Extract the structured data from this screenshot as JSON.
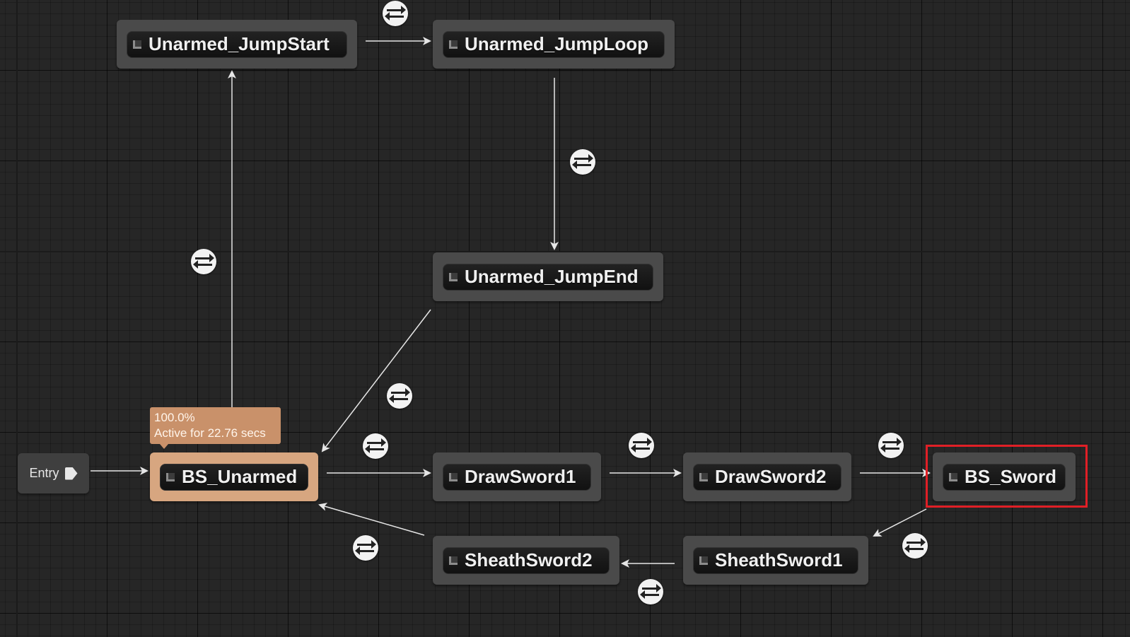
{
  "entry": {
    "label": "Entry"
  },
  "states": {
    "jump_start": "Unarmed_JumpStart",
    "jump_loop": "Unarmed_JumpLoop",
    "jump_end": "Unarmed_JumpEnd",
    "bs_unarmed": "BS_Unarmed",
    "draw_sword1": "DrawSword1",
    "draw_sword2": "DrawSword2",
    "bs_sword": "BS_Sword",
    "sheath_sword2": "SheathSword2",
    "sheath_sword1": "SheathSword1"
  },
  "active_state": {
    "weight": "100.0%",
    "duration": "Active for 22.76 secs"
  },
  "icons": {
    "state": "state-node-icon",
    "entry": "entry-arrow-icon",
    "transition": "transition-rule-icon"
  },
  "colors": {
    "canvas": "#262626",
    "node": "#4a4a4a",
    "active_node": "#d7a680",
    "tooltip": "#c9916a",
    "highlight": "#e01f26",
    "wire": "#e6e6e6"
  }
}
